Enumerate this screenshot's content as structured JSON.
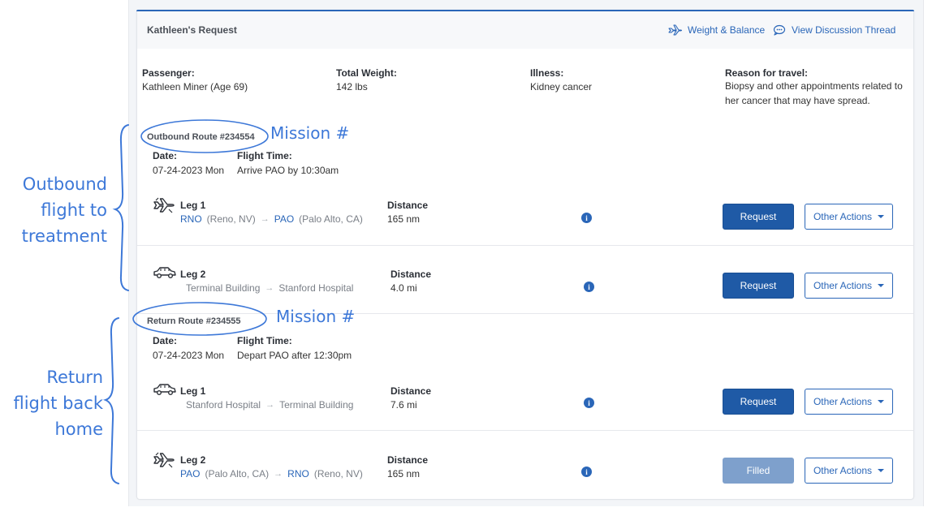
{
  "request": {
    "title": "Kathleen's Request",
    "links": {
      "weight_balance": "Weight & Balance",
      "discussion": "View Discussion Thread"
    },
    "passenger_label": "Passenger:",
    "passenger_value": "Kathleen Miner (Age 69)",
    "weight_label": "Total Weight:",
    "weight_value": "142 lbs",
    "illness_label": "Illness:",
    "illness_value": "Kidney cancer",
    "reason_label": "Reason for travel:",
    "reason_line1": "Biopsy and other appointments related to",
    "reason_line2": "her cancer that may have spread."
  },
  "outbound": {
    "title": "Outbound Route #234554",
    "date_label": "Date:",
    "date_value": "07-24-2023 Mon",
    "flight_time_label": "Flight Time:",
    "flight_time_value": "Arrive PAO by 10:30am",
    "legs": [
      {
        "icon": "plane-icon",
        "title": "Leg 1",
        "from_code": "RNO",
        "from_city": "(Reno, NV)",
        "to_code": "PAO",
        "to_city": "(Palo Alto, CA)",
        "distance_label": "Distance",
        "distance_value": "165 nm",
        "action": "Request",
        "other": "Other Actions"
      },
      {
        "icon": "car-icon",
        "title": "Leg 2",
        "from": "Terminal Building",
        "to": "Stanford Hospital",
        "distance_label": "Distance",
        "distance_value": "4.0 mi",
        "action": "Request",
        "other": "Other Actions"
      }
    ]
  },
  "return": {
    "title": "Return Route #234555",
    "date_label": "Date:",
    "date_value": "07-24-2023 Mon",
    "flight_time_label": "Flight Time:",
    "flight_time_value": "Depart PAO after 12:30pm",
    "legs": [
      {
        "icon": "car-icon",
        "title": "Leg 1",
        "from": "Stanford Hospital",
        "to": "Terminal Building",
        "distance_label": "Distance",
        "distance_value": "7.6 mi",
        "action": "Request",
        "other": "Other Actions"
      },
      {
        "icon": "plane-icon",
        "title": "Leg 2",
        "from_code": "PAO",
        "from_city": "(Palo Alto, CA)",
        "to_code": "RNO",
        "to_city": "(Reno, NV)",
        "distance_label": "Distance",
        "distance_value": "165 nm",
        "action": "Filled",
        "other": "Other Actions"
      }
    ]
  },
  "annotations": {
    "mission_label": "Mission #",
    "outbound_lines": [
      "Outbound",
      "flight to",
      "treatment"
    ],
    "return_lines": [
      "Return",
      "flight back",
      "home"
    ]
  },
  "colors": {
    "accent": "#2a66b8",
    "annotation": "#3d78d8",
    "button_primary": "#1f5aa6",
    "button_filled": "#7ea0cc"
  }
}
